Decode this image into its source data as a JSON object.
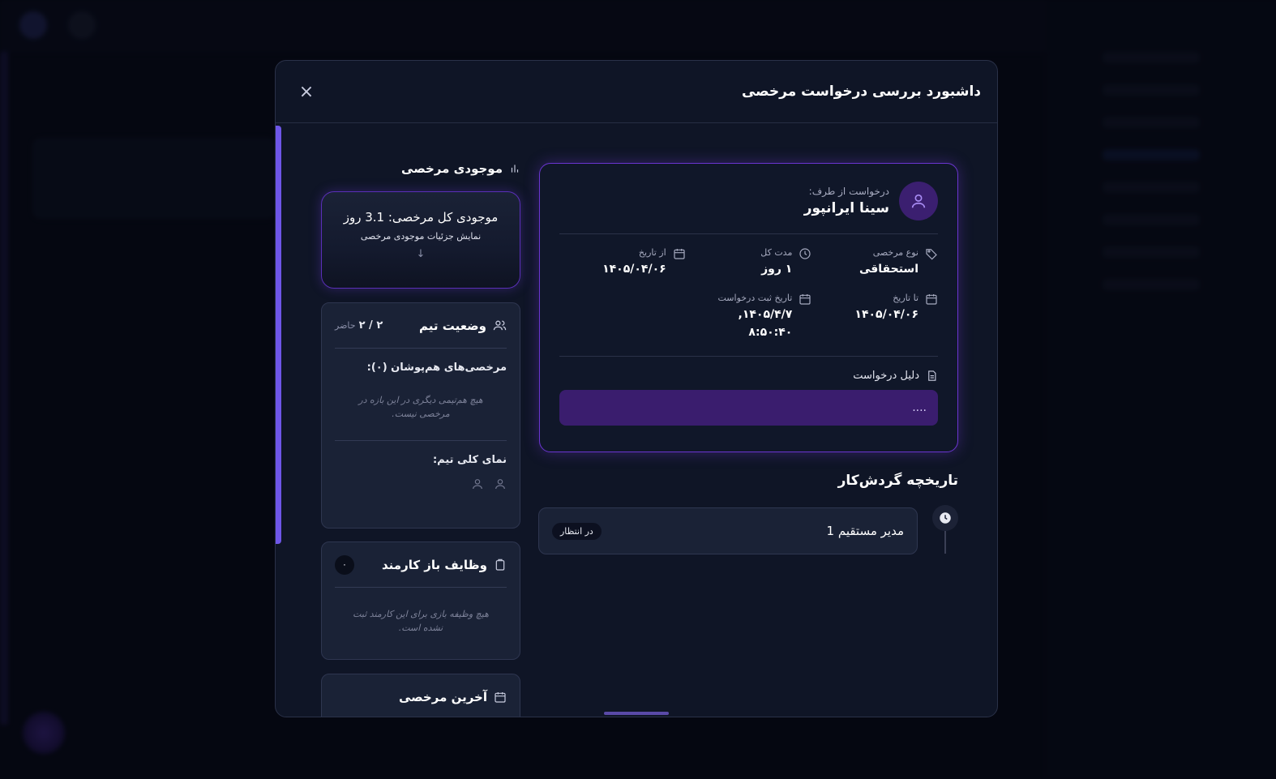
{
  "modal": {
    "title": "داشبورد بررسی درخواست مرخصی",
    "close_icon": "×"
  },
  "request": {
    "from_label": "درخواست از طرف:",
    "name": "سینا ایرانپور",
    "leave_type_label": "نوع مرخصی",
    "leave_type_value": "استحقاقی",
    "duration_label": "مدت کل",
    "duration_value": "۱ روز",
    "from_date_label": "از تاریخ",
    "from_date_value": "۱۴۰۵/۰۴/۰۶",
    "to_date_label": "تا تاریخ",
    "to_date_value": "۱۴۰۵/۰۴/۰۶",
    "submit_date_label": "تاریخ ثبت درخواست",
    "submit_date_value": "۱۴۰۵/۴/۷,",
    "submit_time_value": "۸:۵۰:۴۰",
    "reason_label": "دلیل درخواست",
    "reason_value": "...."
  },
  "workflow": {
    "title": "تاریخچه گردش‌کار",
    "steps": [
      {
        "name": "مدیر مستقیم 1",
        "status": "در انتظار"
      }
    ]
  },
  "balance": {
    "title": "موجودی مرخصی",
    "total": "موجودی کل مرخصی: 3.1 روز",
    "detail": "نمایش جزئیات موجودی مرخصی",
    "arrow": "↓"
  },
  "team": {
    "title": "وضعیت تیم",
    "count": "۲ / ۲",
    "count_suffix": "حاضر",
    "overlap_title": "مرخصی‌های هم‌پوشان (۰):",
    "overlap_empty": "هیچ هم‌تیمی دیگری در این بازه در مرخصی نیست.",
    "overview_title": "نمای کلی تیم:"
  },
  "tasks": {
    "title": "وظایف باز کارمند",
    "count": "۰",
    "empty": "هیچ وظیفه بازی برای این کارمند ثبت نشده است."
  },
  "last_leave": {
    "title": "آخرین مرخصی"
  },
  "colors": {
    "accent": "#6e56e8",
    "card_border": "#6a35d0",
    "reason_bg": "#3a1d6e",
    "modal_bg": "#0f1526"
  }
}
